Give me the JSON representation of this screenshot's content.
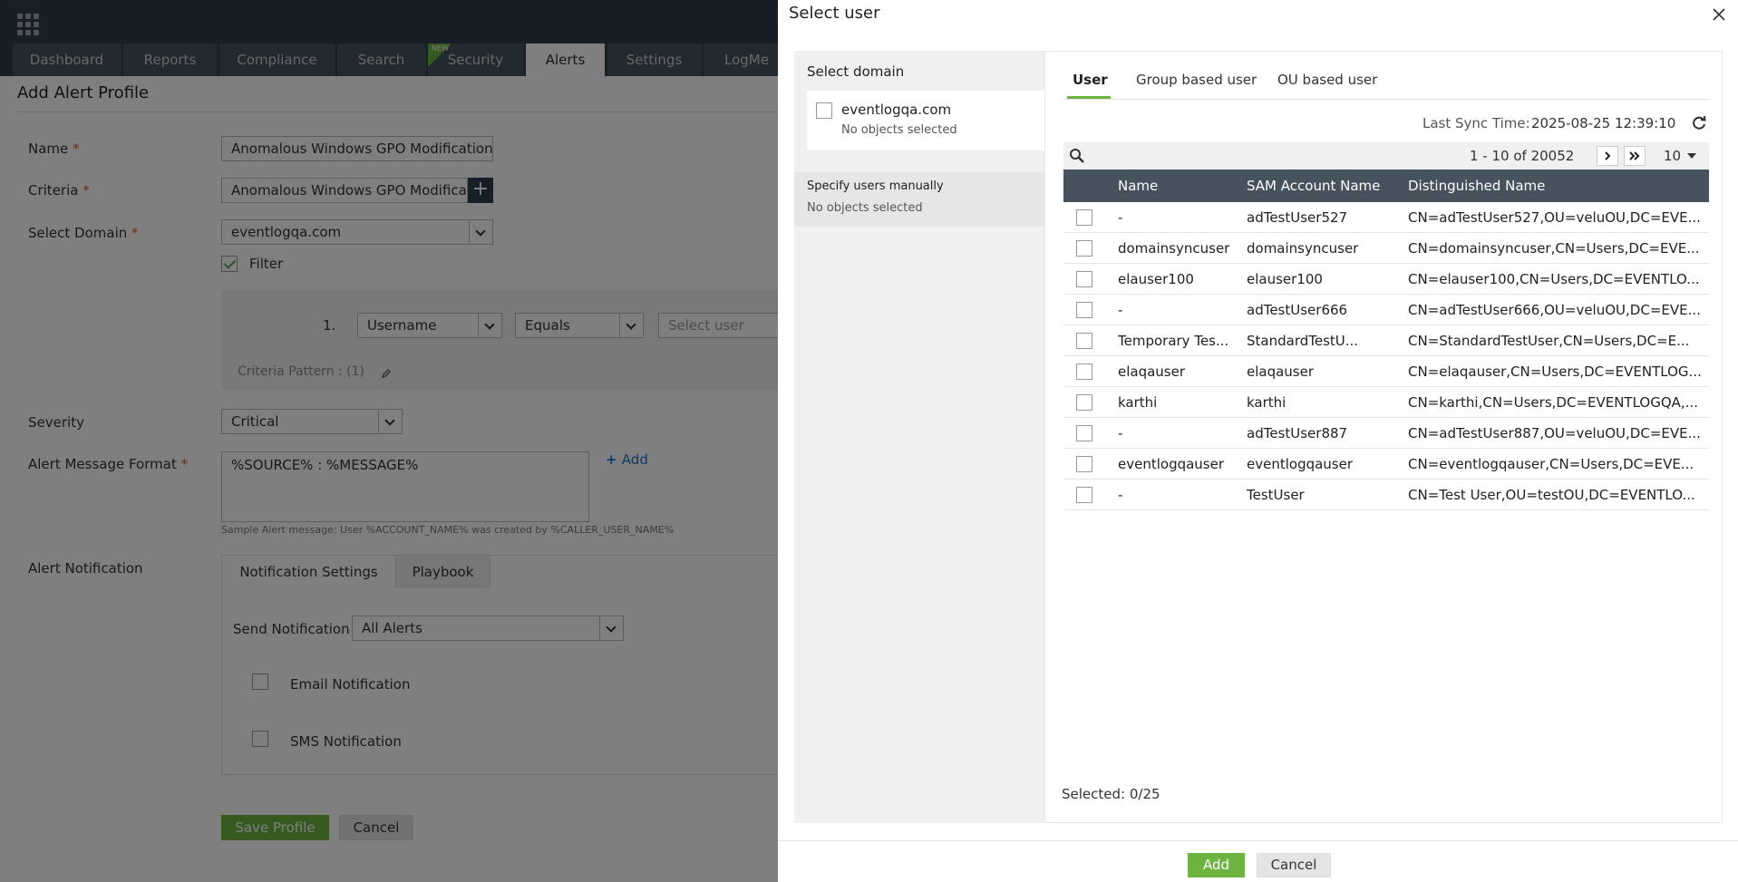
{
  "nav": {
    "tabs": [
      {
        "label": "Dashboard"
      },
      {
        "label": "Reports"
      },
      {
        "label": "Compliance"
      },
      {
        "label": "Search"
      },
      {
        "label": "Security",
        "badge": "NEW"
      },
      {
        "label": "Alerts"
      },
      {
        "label": "Settings"
      },
      {
        "label": "LogMe"
      }
    ],
    "active": "Alerts"
  },
  "form": {
    "title": "Add Alert Profile",
    "name_label": "Name",
    "name_value": "Anomalous Windows GPO Modification",
    "criteria_label": "Criteria",
    "criteria_value": "Anomalous Windows GPO Modification",
    "domain_label": "Select Domain",
    "domain_value": "eventlogqa.com",
    "filter_label": "Filter",
    "filter_checked": true,
    "filter_row": {
      "index": "1.",
      "field": "Username",
      "operator": "Equals",
      "value_placeholder": "Select user"
    },
    "criteria_pattern": "Criteria Pattern : (1)",
    "severity_label": "Severity",
    "severity_value": "Critical",
    "message_label": "Alert Message Format",
    "message_value": "%SOURCE% : %MESSAGE%",
    "add_link": "Add",
    "sample_message": "Sample Alert message: User %ACCOUNT_NAME% was created by %CALLER_USER_NAME%",
    "notification_label": "Alert Notification",
    "notification_tabs": [
      "Notification Settings",
      "Playbook"
    ],
    "send_notification_label": "Send Notification",
    "send_notification_value": "All Alerts",
    "email_label": "Email Notification",
    "sms_label": "SMS Notification",
    "save_label": "Save Profile",
    "cancel_label": "Cancel"
  },
  "drawer": {
    "title": "Select user",
    "select_domain_label": "Select domain",
    "domain": {
      "name": "eventlogqa.com",
      "status": "No objects selected"
    },
    "manual": {
      "label": "Specify users manually",
      "status": "No objects selected"
    },
    "tabs": [
      "User",
      "Group based user",
      "OU based user"
    ],
    "active_tab": "User",
    "sync_label": "Last Sync Time:",
    "sync_value": "2025-08-25 12:39:10",
    "pager": {
      "range": "1 - 10 of 20052",
      "page_size": "10"
    },
    "columns": [
      "Name",
      "SAM Account Name",
      "Distinguished Name"
    ],
    "rows": [
      {
        "name": "-",
        "sam": "adTestUser527",
        "dn": "CN=adTestUser527,OU=veluOU,DC=EVE..."
      },
      {
        "name": "domainsyncuser",
        "sam": "domainsyncuser",
        "dn": "CN=domainsyncuser,CN=Users,DC=EVE..."
      },
      {
        "name": "elauser100",
        "sam": "elauser100",
        "dn": "CN=elauser100,CN=Users,DC=EVENTLO..."
      },
      {
        "name": "-",
        "sam": "adTestUser666",
        "dn": "CN=adTestUser666,OU=veluOU,DC=EVE..."
      },
      {
        "name": "Temporary Tes...",
        "sam": "StandardTestU...",
        "dn": "CN=StandardTestUser,CN=Users,DC=E..."
      },
      {
        "name": "elaqauser",
        "sam": "elaqauser",
        "dn": "CN=elaqauser,CN=Users,DC=EVENTLOG..."
      },
      {
        "name": "karthi",
        "sam": "karthi",
        "dn": "CN=karthi,CN=Users,DC=EVENTLOGQA,..."
      },
      {
        "name": "-",
        "sam": "adTestUser887",
        "dn": "CN=adTestUser887,OU=veluOU,DC=EVE..."
      },
      {
        "name": "eventlogqauser",
        "sam": "eventlogqauser",
        "dn": "CN=eventlogqauser,CN=Users,DC=EVE..."
      },
      {
        "name": "-",
        "sam": "TestUser",
        "dn": "CN=Test User,OU=testOU,DC=EVENTLO..."
      }
    ],
    "selected_count": "Selected: 0/25",
    "add_label": "Add",
    "cancel_label": "Cancel"
  },
  "colors": {
    "nav_bg": "#2f3c4a",
    "accent_green": "#6cb33f",
    "table_header": "#46535f",
    "required": "#e05a2a",
    "link": "#1a73c8"
  }
}
